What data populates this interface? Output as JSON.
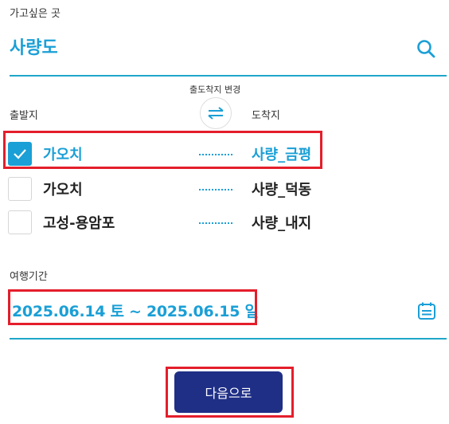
{
  "destination": {
    "label": "가고싶은 곳",
    "value": "사량도"
  },
  "route": {
    "swap_label": "출도착지 변경",
    "departure_header": "출발지",
    "arrival_header": "도착지",
    "options": [
      {
        "departure": "가오치",
        "arrival": "사량_금평",
        "checked": true
      },
      {
        "departure": "가오치",
        "arrival": "사량_덕동",
        "checked": false
      },
      {
        "departure": "고성-용암포",
        "arrival": "사량_내지",
        "checked": false
      }
    ]
  },
  "period": {
    "label": "여행기간",
    "value": "2025.06.14 토 ~ 2025.06.15 일"
  },
  "next_button": {
    "label": "다음으로"
  },
  "colors": {
    "accent": "#1a9fd6",
    "line": "#1fa6c9",
    "button": "#1f2f86",
    "highlight": "#e41e2b"
  }
}
